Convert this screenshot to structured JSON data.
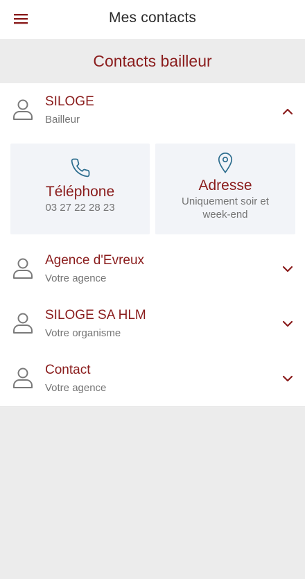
{
  "header": {
    "title": "Mes contacts",
    "menu_icon": "hamburger-icon"
  },
  "section": {
    "title": "Contacts bailleur"
  },
  "contacts": [
    {
      "name": "SILOGE",
      "subtitle": "Bailleur",
      "expanded": true,
      "details": {
        "phone": {
          "title": "Téléphone",
          "value": "03 27 22 28 23",
          "icon": "phone-icon"
        },
        "address": {
          "title": "Adresse",
          "value": "Uniquement soir et week-end",
          "icon": "map-pin-icon"
        }
      }
    },
    {
      "name": "Agence d'Evreux",
      "subtitle": "Votre agence",
      "expanded": false
    },
    {
      "name": "SILOGE SA HLM",
      "subtitle": "Votre organisme",
      "expanded": false
    },
    {
      "name": "Contact",
      "subtitle": "Votre agence",
      "expanded": false
    }
  ],
  "colors": {
    "accent": "#8a1c1c",
    "icon_blue": "#2e6e8f",
    "background": "#ececec",
    "card_bg": "#f2f4f8"
  }
}
